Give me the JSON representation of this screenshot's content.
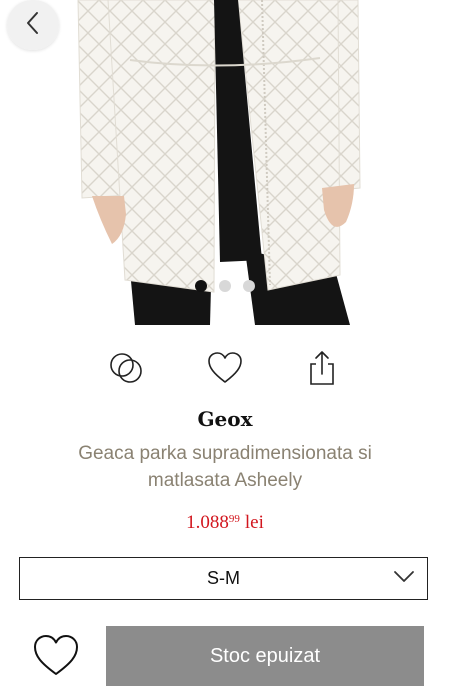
{
  "product": {
    "brand": "Geox",
    "name": "Geaca parka supradimensionata si matlasata Asheely",
    "price": {
      "whole": "1.088",
      "cents": "99",
      "currency": "lei"
    }
  },
  "gallery": {
    "image_count": 3,
    "active_index": 0
  },
  "size": {
    "selected": "S-M"
  },
  "cta": {
    "label": "Stoc epuizat"
  },
  "colors": {
    "price": "#d2161e",
    "cta_bg": "#8c8c8c",
    "name_text": "#8a8272"
  },
  "icons": {
    "back": "chevron-left-icon",
    "similar": "overlapping-circles-icon",
    "wishlist": "heart-icon",
    "share": "share-icon",
    "dropdown": "chevron-down-icon"
  }
}
